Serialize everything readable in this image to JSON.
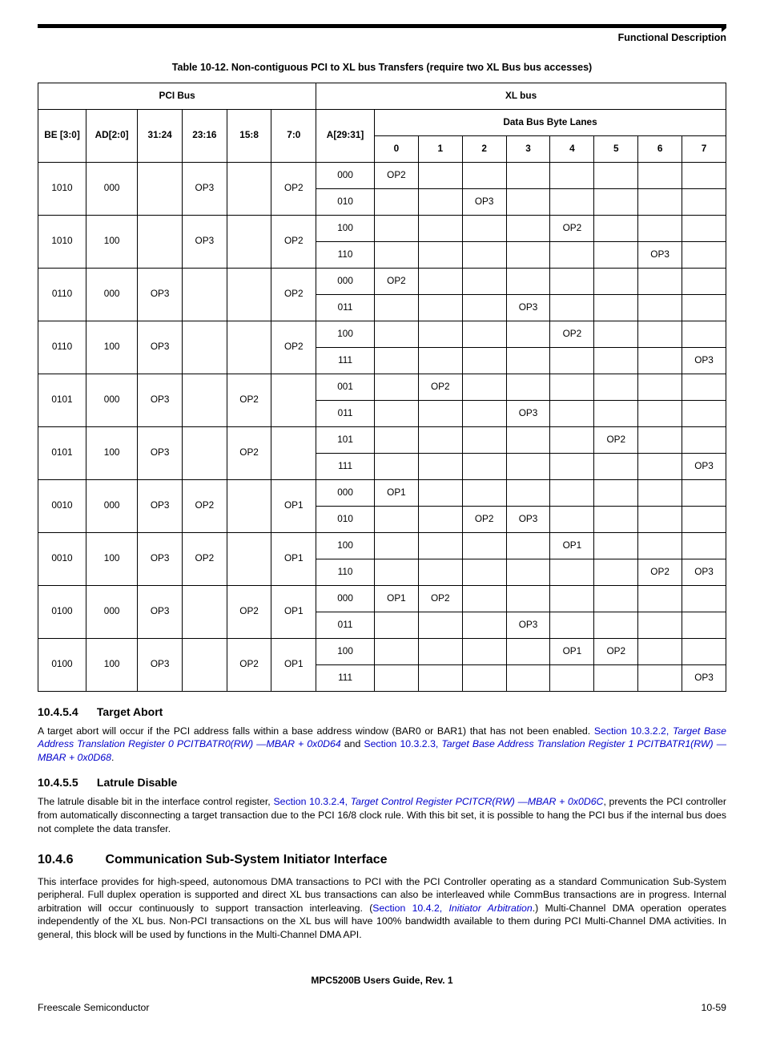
{
  "header_label": "Functional Description",
  "table_caption": "Table 10-12. Non-contiguous PCI to XL bus Transfers (require two XL Bus bus accesses)",
  "chart_data": {
    "type": "table",
    "header_groups": {
      "pci": "PCI Bus",
      "xl": "XL bus",
      "lanes": "Data Bus Byte Lanes"
    },
    "columns": [
      "BE [3:0]",
      "AD[2:0]",
      "31:24",
      "23:16",
      "15:8",
      "7:0",
      "A[29:31]",
      "0",
      "1",
      "2",
      "3",
      "4",
      "5",
      "6",
      "7"
    ],
    "rows": [
      [
        "1010",
        "000",
        "",
        "OP3",
        "",
        "OP2",
        "000",
        "OP2",
        "",
        "",
        "",
        "",
        "",
        "",
        ""
      ],
      [
        "",
        "",
        "",
        "",
        "",
        "",
        "010",
        "",
        "",
        "OP3",
        "",
        "",
        "",
        "",
        ""
      ],
      [
        "1010",
        "100",
        "",
        "OP3",
        "",
        "OP2",
        "100",
        "",
        "",
        "",
        "",
        "OP2",
        "",
        "",
        ""
      ],
      [
        "",
        "",
        "",
        "",
        "",
        "",
        "110",
        "",
        "",
        "",
        "",
        "",
        "",
        "OP3",
        ""
      ],
      [
        "0110",
        "000",
        "OP3",
        "",
        "",
        "OP2",
        "000",
        "OP2",
        "",
        "",
        "",
        "",
        "",
        "",
        ""
      ],
      [
        "",
        "",
        "",
        "",
        "",
        "",
        "011",
        "",
        "",
        "",
        "OP3",
        "",
        "",
        "",
        ""
      ],
      [
        "0110",
        "100",
        "OP3",
        "",
        "",
        "OP2",
        "100",
        "",
        "",
        "",
        "",
        "OP2",
        "",
        "",
        ""
      ],
      [
        "",
        "",
        "",
        "",
        "",
        "",
        "111",
        "",
        "",
        "",
        "",
        "",
        "",
        "",
        "OP3"
      ],
      [
        "0101",
        "000",
        "OP3",
        "",
        "OP2",
        "",
        "001",
        "",
        "OP2",
        "",
        "",
        "",
        "",
        "",
        ""
      ],
      [
        "",
        "",
        "",
        "",
        "",
        "",
        "011",
        "",
        "",
        "",
        "OP3",
        "",
        "",
        "",
        ""
      ],
      [
        "0101",
        "100",
        "OP3",
        "",
        "OP2",
        "",
        "101",
        "",
        "",
        "",
        "",
        "",
        "OP2",
        "",
        ""
      ],
      [
        "",
        "",
        "",
        "",
        "",
        "",
        "111",
        "",
        "",
        "",
        "",
        "",
        "",
        "",
        "OP3"
      ],
      [
        "0010",
        "000",
        "OP3",
        "OP2",
        "",
        "OP1",
        "000",
        "OP1",
        "",
        "",
        "",
        "",
        "",
        "",
        ""
      ],
      [
        "",
        "",
        "",
        "",
        "",
        "",
        "010",
        "",
        "",
        "OP2",
        "OP3",
        "",
        "",
        "",
        ""
      ],
      [
        "0010",
        "100",
        "OP3",
        "OP2",
        "",
        "OP1",
        "100",
        "",
        "",
        "",
        "",
        "OP1",
        "",
        "",
        ""
      ],
      [
        "",
        "",
        "",
        "",
        "",
        "",
        "110",
        "",
        "",
        "",
        "",
        "",
        "",
        "OP2",
        "OP3"
      ],
      [
        "0100",
        "000",
        "OP3",
        "",
        "OP2",
        "OP1",
        "000",
        "OP1",
        "OP2",
        "",
        "",
        "",
        "",
        "",
        ""
      ],
      [
        "",
        "",
        "",
        "",
        "",
        "",
        "011",
        "",
        "",
        "",
        "OP3",
        "",
        "",
        "",
        ""
      ],
      [
        "0100",
        "100",
        "OP3",
        "",
        "OP2",
        "OP1",
        "100",
        "",
        "",
        "",
        "",
        "OP1",
        "OP2",
        "",
        ""
      ],
      [
        "",
        "",
        "",
        "",
        "",
        "",
        "111",
        "",
        "",
        "",
        "",
        "",
        "",
        "",
        "OP3"
      ]
    ]
  },
  "s1": {
    "num": "10.4.5.4",
    "title": "Target Abort",
    "p_a": "A target abort will occur if the PCI address falls within a base address window (BAR0 or BAR1) that has not been enabled. ",
    "link1_sec": "Section 10.3.2.2, ",
    "link1_title": "Target Base Address Translation Register 0 PCITBATR0(RW) —MBAR + 0x0D64",
    "p_b": " and ",
    "link2_sec": "Section 10.3.2.3, ",
    "link2_title": "Target Base Address Translation Register 1 PCITBATR1(RW) —MBAR + 0x0D68",
    "p_c": "."
  },
  "s2": {
    "num": "10.4.5.5",
    "title": "Latrule Disable",
    "p_a": "The latrule disable bit in the interface control register, ",
    "link_sec": "Section 10.3.2.4, ",
    "link_title": "Target Control Register PCITCR(RW) —MBAR + 0x0D6C",
    "p_b": ", prevents the PCI controller from automatically disconnecting a target transaction due to the PCI 16/8 clock rule. With this bit set, it is possible to hang the PCI bus if the internal bus does not complete the data transfer."
  },
  "s3": {
    "num": "10.4.6",
    "title": "Communication Sub-System Initiator Interface",
    "p_a": "This interface provides for high-speed, autonomous DMA transactions to PCI with the PCI Controller operating as a standard Communication Sub-System peripheral. Full duplex operation is supported and direct XL bus transactions can also be interleaved while CommBus transactions are in progress. Internal arbitration will occur continuously to support transaction interleaving. (",
    "link_sec": "Section 10.4.2, ",
    "link_title": "Initiator Arbitration",
    "p_b": ".) Multi-Channel DMA operation operates independently of the XL bus. Non-PCI transactions on the XL bus will have 100% bandwidth available to them during PCI Multi-Channel DMA activities. In general, this block will be used by functions in the Multi-Channel DMA API."
  },
  "footer": {
    "center": "MPC5200B Users Guide, Rev. 1",
    "left": "Freescale Semiconductor",
    "right": "10-59"
  }
}
